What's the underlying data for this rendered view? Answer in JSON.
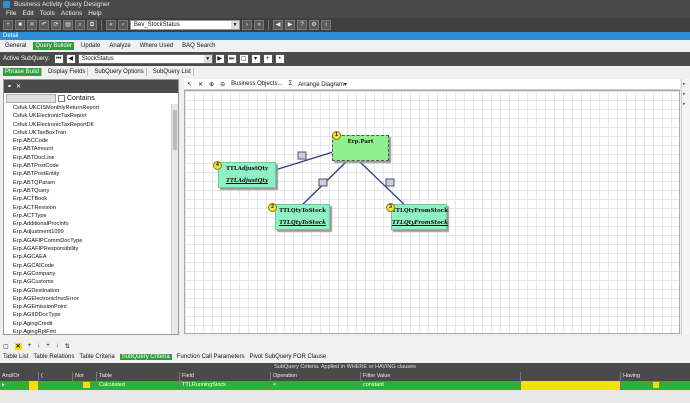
{
  "window": {
    "title": "Business Activity Query Designer"
  },
  "menu": [
    "File",
    "Edit",
    "Tools",
    "Actions",
    "Help"
  ],
  "toolbar": {
    "query_combo": "Bev_StockStatus"
  },
  "detail_label": "Detail",
  "main_tabs": [
    {
      "label": "General",
      "active": false
    },
    {
      "label": "Query Builder",
      "active": true
    },
    {
      "label": "Update",
      "active": false
    },
    {
      "label": "Analyze",
      "active": false
    },
    {
      "label": "Where Used",
      "active": false
    },
    {
      "label": "BAQ Search",
      "active": false
    }
  ],
  "subquery": {
    "label": "Active SubQuery:",
    "value": "StockStatus"
  },
  "sub_tabs": [
    {
      "label": "Phrase Build",
      "active": true
    },
    {
      "label": "Display Fields",
      "active": false
    },
    {
      "label": "SubQuery Options",
      "active": false
    },
    {
      "label": "SubQuery List",
      "active": false
    }
  ],
  "table_search": {
    "contains_label": "Contains"
  },
  "tables": [
    "Csfuk.UKCISMonthlyReturnReport",
    "Csfuk.UKElectronicTaxReport",
    "Csfuk.UKElectronicTaxReportDtl",
    "Csfuk.UKTaxBoxTran",
    "Erp.ABCCode",
    "Erp.ABTAmount",
    "Erp.ABTDocLine",
    "Erp.ABTPostCode",
    "Erp.ABTPostEntity",
    "Erp.ABTQParam",
    "Erp.ABTQuery",
    "Erp.ACTBook",
    "Erp.ACTRevision",
    "Erp.ACTType",
    "Erp.AdditionalProcInfo",
    "Erp.Adjustment1099",
    "Erp.AGAFIPCommDocType",
    "Erp.AGAFIPResponsibility",
    "Erp.AGCAEA",
    "Erp.AGCAICode",
    "Erp.AGCompany",
    "Erp.AGCustoms",
    "Erp.AGDestination",
    "Erp.AGElectronicInvcError",
    "Erp.AGEmissionPoint",
    "Erp.AGIIDDocType",
    "Erp.AgingCredit",
    "Erp.AgingRptFmt"
  ],
  "diagram_tools": {
    "business_objects": "Business Objects...",
    "arrange": "Arrange Diagram"
  },
  "nodes": [
    {
      "num": "1",
      "title": "Erp.Part",
      "sub": ""
    },
    {
      "num": "2",
      "title": "TTLQtyToStock",
      "sub": "TTLQtyToStock"
    },
    {
      "num": "3",
      "title": "TTLQtyFromStock",
      "sub": "TTLQtyFromStock"
    },
    {
      "num": "4",
      "title": "TTLAdjustQty",
      "sub": "TTLAdjustQty"
    }
  ],
  "bottom_tabs": [
    {
      "label": "Table List",
      "active": false
    },
    {
      "label": "Table Relations",
      "active": false
    },
    {
      "label": "Table Criteria",
      "active": false
    },
    {
      "label": "SubQuery Criteria",
      "active": true
    },
    {
      "label": "Function Call Parameters",
      "active": false
    },
    {
      "label": "Pivot SubQuery FOR Clause",
      "active": false
    }
  ],
  "criteria": {
    "caption": "SubQuery Criteria. Applied in WHERE or HAVING clauses",
    "columns": [
      "And/Or",
      "(",
      "Not",
      "Table",
      "Field",
      "Operation",
      "Filter Value",
      "",
      "Having"
    ],
    "row": {
      "table": "Calculated",
      "field": "TTLRunningStock",
      "operation": "<",
      "value": "constant"
    }
  }
}
